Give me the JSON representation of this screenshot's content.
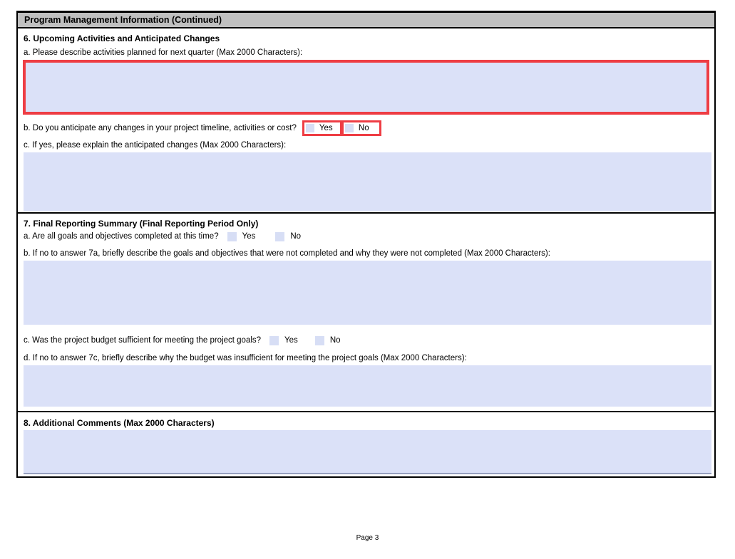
{
  "colors": {
    "highlight_red": "#ee3d44",
    "field_blue": "#dbe1f8",
    "checkbox_blue": "#d7def5",
    "header_gray": "#c0c0c0"
  },
  "header": {
    "title": "Program Management Information (Continued)"
  },
  "sections": {
    "s6": {
      "title": "6. Upcoming Activities and Anticipated Changes",
      "a_label": "a. Please describe activities planned for next quarter (Max 2000 Characters):",
      "a_value": "",
      "b_label": "b. Do you anticipate any changes in your project timeline, activities or cost?",
      "b_options": {
        "yes": "Yes",
        "no": "No"
      },
      "c_label": "c. If yes, please explain the anticipated changes (Max 2000 Characters):",
      "c_value": ""
    },
    "s7": {
      "title": "7. Final Reporting Summary (Final Reporting Period Only)",
      "a_label": "a. Are all goals and objectives completed at this time?",
      "a_options": {
        "yes": "Yes",
        "no": "No"
      },
      "b_label": "b. If no to answer 7a, briefly describe the goals and objectives that were not completed and why they were not completed (Max 2000 Characters):",
      "b_value": "",
      "c_label": "c. Was the project budget sufficient for meeting the project goals?",
      "c_options": {
        "yes": "Yes",
        "no": "No"
      },
      "d_label": "d. If no to answer 7c, briefly describe why the budget was insufficient for meeting the project goals (Max 2000 Characters):",
      "d_value": ""
    },
    "s8": {
      "title": "8. Additional Comments (Max 2000 Characters)",
      "value": ""
    }
  },
  "footer": {
    "page_label": "Page 3"
  }
}
